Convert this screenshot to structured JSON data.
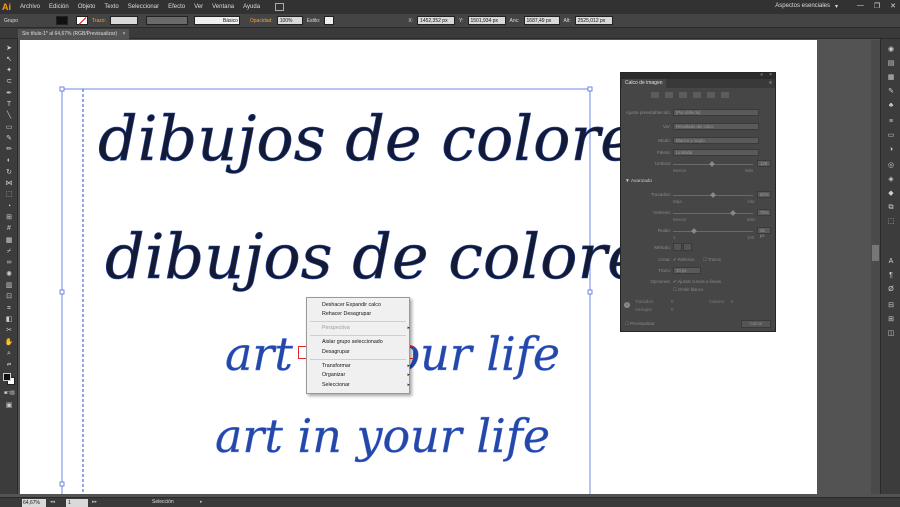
{
  "app": {
    "logo": "Ai"
  },
  "menu": [
    "Archivo",
    "Edición",
    "Objeto",
    "Texto",
    "Seleccionar",
    "Efecto",
    "Ver",
    "Ventana",
    "Ayuda"
  ],
  "workspace": {
    "label": "Aspectos esenciales",
    "arrow": "▾"
  },
  "window_controls": [
    "—",
    "❐",
    "✕"
  ],
  "control_bar": {
    "selection_label": "Grupo",
    "stroke_label": "Trazo:",
    "brush_label": "Básico",
    "opacity_label": "Opacidad:",
    "opacity_value": "100%",
    "style_label": "Estilo:",
    "x_label": "X:",
    "x_value": "1452,352 px",
    "y_label": "Y:",
    "y_value": "1501,934 px",
    "w_label": "Anc:",
    "w_value": "1687,49 px",
    "h_label": "Alt:",
    "h_value": "2525,012 px"
  },
  "document_tab": {
    "title": "Sin título-1* al 64,67% (RGB/Previsualizar)",
    "close": "×"
  },
  "artwork": {
    "lines": [
      "dibujos de colores",
      "dibujos de colores",
      "art in your life",
      "art in your life"
    ],
    "colors": {
      "dark": "#141a33",
      "blue": "#2447a8",
      "bbox": "#4a6fd9"
    }
  },
  "context_menu": {
    "items": [
      {
        "label": "Deshacer Expandir calco",
        "disabled": false,
        "submenu": false
      },
      {
        "label": "Rehacer Desagrupar",
        "disabled": false,
        "submenu": false
      },
      {
        "label": "Perspectiva",
        "disabled": true,
        "submenu": true
      },
      {
        "label": "Aislar grupo seleccionado",
        "disabled": false,
        "submenu": false
      },
      {
        "label": "Desagrupar",
        "disabled": false,
        "submenu": false
      },
      {
        "label": "Transformar",
        "disabled": false,
        "submenu": true
      },
      {
        "label": "Organizar",
        "disabled": false,
        "submenu": true
      },
      {
        "label": "Seleccionar",
        "disabled": false,
        "submenu": true
      }
    ],
    "highlight_color": "#e5262b"
  },
  "trace_panel": {
    "title": "Calco de imagen",
    "preset_label": "Ajuste preestablecido:",
    "preset_value": "[Por defecto]",
    "view_label": "Ver:",
    "view_value": "Resultado del calco",
    "mode_label": "Modo:",
    "mode_value": "Blanco y negro",
    "palette_label": "Paleta:",
    "palette_value": "Limitada",
    "threshold_label": "Umbral:",
    "threshold_value": "128",
    "threshold_min": "Menos",
    "threshold_max": "Más",
    "advanced_label": "Avanzado",
    "paths_label": "Trazados:",
    "paths_value": "50%",
    "paths_min": "Baja",
    "paths_max": "Alta",
    "corners_label": "Vértices:",
    "corners_value": "75%",
    "corners_min": "Menos",
    "corners_max": "Más",
    "noise_label": "Ruido:",
    "noise_value": "25 px",
    "noise_min": "1",
    "noise_max": "100",
    "method_label": "Método:",
    "create_label": "Crear:",
    "fills_label": "Rellenos",
    "strokes_label": "Trazos",
    "stroke_label": "Trazo:",
    "stroke_value": "10 px",
    "options_label": "Opciones:",
    "snap_label": "Ajustar curvas a líneas",
    "ignore_label": "Omitir blanco",
    "paths_count_label": "Trazados:",
    "paths_count": "0",
    "colors_count_label": "Colores:",
    "colors_count": "0",
    "anchors_label": "Anclajes:",
    "anchors_count": "0",
    "preview_label": "Previsualizar",
    "trace_button": "Calcar"
  },
  "status_bar": {
    "zoom": "64,67%",
    "page": "1",
    "tool": "Selección"
  }
}
